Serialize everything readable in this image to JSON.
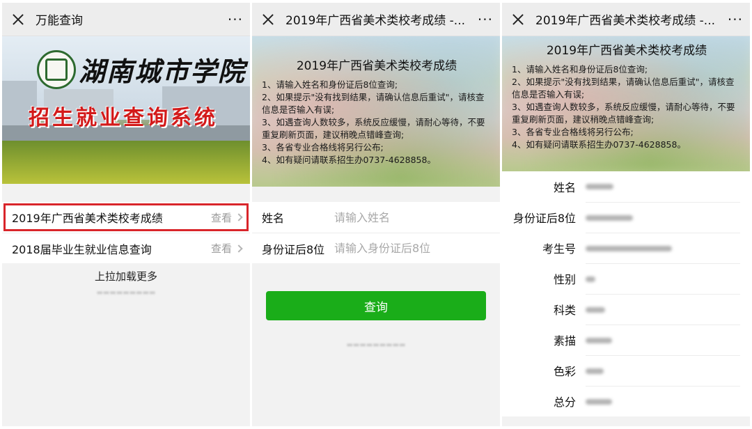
{
  "screen1": {
    "title": "万能查询",
    "more": "···",
    "banner": {
      "school_name": "湖南城市学院",
      "subtitle": "招生就业查询系统"
    },
    "list": [
      {
        "label": "2019年广西省美术类校考成绩",
        "action": "查看",
        "highlighted": true
      },
      {
        "label": "2018届毕业生就业信息查询",
        "action": "查看",
        "highlighted": false
      }
    ],
    "load_more": "上拉加载更多",
    "highlight_color": "#d9252a"
  },
  "screen2": {
    "title": "2019年广西省美术类校考成绩 -...",
    "more": "···",
    "banner_title": "2019年广西省美术类校考成绩",
    "notes": [
      "1、请输入姓名和身份证后8位查询;",
      "2、如果提示\"没有找到结果，请确认信息后重试\"，请核查信息是否输入有误;",
      "3、如遇查询人数较多，系统反应缓慢，请耐心等待，不要重复刷新页面，建议稍晚点错峰查询;",
      "3、各省专业合格线将另行公布;",
      "4、如有疑问请联系招生办0737-4628858。"
    ],
    "fields": [
      {
        "label": "姓名",
        "placeholder": "请输入姓名"
      },
      {
        "label": "身份证后8位",
        "placeholder": "请输入身份证后8位"
      }
    ],
    "submit_label": "查询",
    "button_color": "#1aad19"
  },
  "screen3": {
    "title": "2019年广西省美术类校考成绩 -...",
    "more": "···",
    "banner_title": "2019年广西省美术类校考成绩",
    "notes": [
      "1、请输入姓名和身份证后8位查询;",
      "2、如果提示\"没有找到结果，请确认信息后重试\"，请核查信息是否输入有误;",
      "3、如遇查询人数较多，系统反应缓慢，请耐心等待，不要重复刷新页面，建议稍晚点错峰查询;",
      "3、各省专业合格线将另行公布;",
      "4、如有疑问请联系招生办0737-4628858。"
    ],
    "results": [
      {
        "label": "姓名"
      },
      {
        "label": "身份证后8位"
      },
      {
        "label": "考生号"
      },
      {
        "label": "性别"
      },
      {
        "label": "科类"
      },
      {
        "label": "素描"
      },
      {
        "label": "色彩"
      },
      {
        "label": "总分"
      }
    ]
  }
}
